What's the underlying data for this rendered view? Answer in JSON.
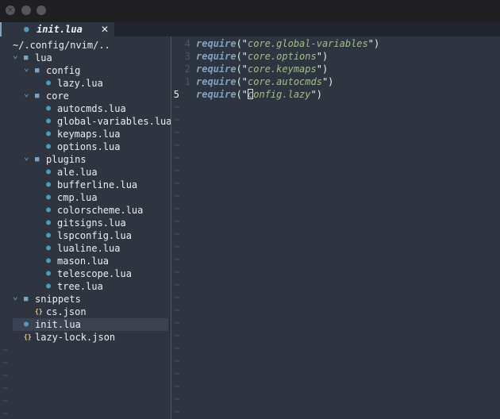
{
  "window": {
    "title_bar_buttons": [
      "close",
      "minimize",
      "maximize"
    ],
    "close_glyph": "×"
  },
  "tabline": {
    "active_tab": {
      "icon": "lua-file-icon",
      "label": "init.lua",
      "close_glyph": "✕"
    }
  },
  "explorer": {
    "root": "~/.config/nvim/..",
    "rows": [
      {
        "type": "folder",
        "label": "lua",
        "depth": 0,
        "expanded": true
      },
      {
        "type": "folder",
        "label": "config",
        "depth": 1,
        "expanded": true
      },
      {
        "type": "lua",
        "label": "lazy.lua",
        "depth": 2
      },
      {
        "type": "folder",
        "label": "core",
        "depth": 1,
        "expanded": true
      },
      {
        "type": "lua",
        "label": "autocmds.lua",
        "depth": 2
      },
      {
        "type": "lua",
        "label": "global-variables.lua",
        "depth": 2
      },
      {
        "type": "lua",
        "label": "keymaps.lua",
        "depth": 2
      },
      {
        "type": "lua",
        "label": "options.lua",
        "depth": 2
      },
      {
        "type": "folder",
        "label": "plugins",
        "depth": 1,
        "expanded": true
      },
      {
        "type": "lua",
        "label": "ale.lua",
        "depth": 2
      },
      {
        "type": "lua",
        "label": "bufferline.lua",
        "depth": 2
      },
      {
        "type": "lua",
        "label": "cmp.lua",
        "depth": 2
      },
      {
        "type": "lua",
        "label": "colorscheme.lua",
        "depth": 2
      },
      {
        "type": "lua",
        "label": "gitsigns.lua",
        "depth": 2
      },
      {
        "type": "lua",
        "label": "lspconfig.lua",
        "depth": 2
      },
      {
        "type": "lua",
        "label": "lualine.lua",
        "depth": 2
      },
      {
        "type": "lua",
        "label": "mason.lua",
        "depth": 2
      },
      {
        "type": "lua",
        "label": "telescope.lua",
        "depth": 2
      },
      {
        "type": "lua",
        "label": "tree.lua",
        "depth": 2
      },
      {
        "type": "folder",
        "label": "snippets",
        "depth": 0,
        "expanded": true
      },
      {
        "type": "json",
        "label": "cs.json",
        "depth": 1
      },
      {
        "type": "lua",
        "label": "init.lua",
        "depth": 0,
        "selected": true
      },
      {
        "type": "json",
        "label": "lazy-lock.json",
        "depth": 0
      }
    ],
    "empty_line_marker": "~"
  },
  "editor": {
    "lines": [
      {
        "number": "4",
        "keyword": "require",
        "open": "(\"",
        "string": "core.global-variables",
        "close": "\")"
      },
      {
        "number": "3",
        "keyword": "require",
        "open": "(\"",
        "string": "core.options",
        "close": "\")"
      },
      {
        "number": "2",
        "keyword": "require",
        "open": "(\"",
        "string": "core.keymaps",
        "close": "\")"
      },
      {
        "number": "1",
        "keyword": "require",
        "open": "(\"",
        "string": "core.autocmds",
        "close": "\")"
      },
      {
        "number": "5",
        "keyword": "require",
        "open": "(\"",
        "string": "config.lazy",
        "close": "\")",
        "current": true
      }
    ],
    "empty_line_marker": "~"
  },
  "colors": {
    "background": "#2e3440",
    "keyword": "#81a1c1",
    "string": "#a3be8c",
    "root_path": "#b48ead",
    "lua_icon": "#519aba",
    "json_icon": "#ebcb8b",
    "line_number": "#4c566a"
  }
}
